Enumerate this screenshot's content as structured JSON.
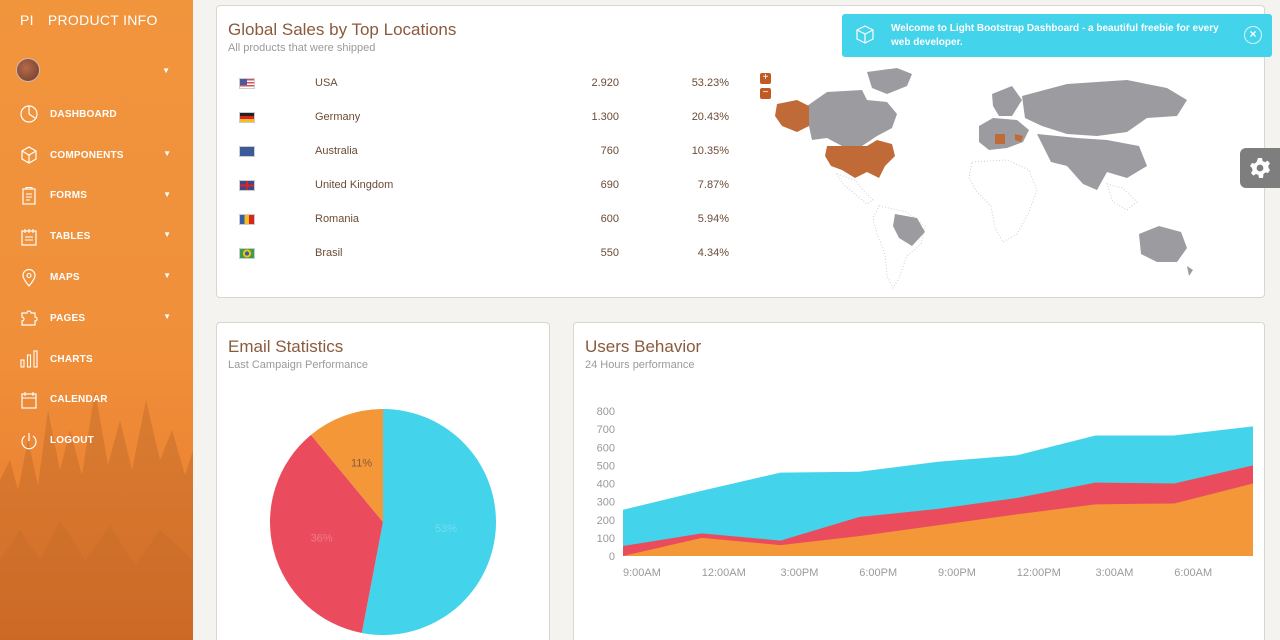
{
  "sidebar": {
    "logo_mini": "PI",
    "logo_text": "PRODUCT INFO",
    "items": [
      {
        "label": "DASHBOARD",
        "icon": "pie-chart-icon",
        "has_caret": false
      },
      {
        "label": "COMPONENTS",
        "icon": "cube-icon",
        "has_caret": true
      },
      {
        "label": "FORMS",
        "icon": "clipboard-icon",
        "has_caret": true
      },
      {
        "label": "TABLES",
        "icon": "notes-icon",
        "has_caret": true
      },
      {
        "label": "MAPS",
        "icon": "map-pin-icon",
        "has_caret": true
      },
      {
        "label": "PAGES",
        "icon": "puzzle-icon",
        "has_caret": true
      },
      {
        "label": "CHARTS",
        "icon": "bar-chart-icon",
        "has_caret": false
      },
      {
        "label": "CALENDAR",
        "icon": "calendar-icon",
        "has_caret": false
      },
      {
        "label": "LOGOUT",
        "icon": "power-icon",
        "has_caret": false
      }
    ]
  },
  "sales": {
    "title": "Global Sales by Top Locations",
    "subtitle": "All products that were shipped",
    "rows": [
      {
        "country": "USA",
        "value": "2.920",
        "percent": "53.23%"
      },
      {
        "country": "Germany",
        "value": "1.300",
        "percent": "20.43%"
      },
      {
        "country": "Australia",
        "value": "760",
        "percent": "10.35%"
      },
      {
        "country": "United Kingdom",
        "value": "690",
        "percent": "7.87%"
      },
      {
        "country": "Romania",
        "value": "600",
        "percent": "5.94%"
      },
      {
        "country": "Brasil",
        "value": "550",
        "percent": "4.34%"
      }
    ],
    "zoom_in": "+",
    "zoom_out": "−"
  },
  "notification": {
    "message": "Welcome to Light Bootstrap Dashboard - a beautiful freebie for every web developer.",
    "close": "×"
  },
  "email": {
    "title": "Email Statistics",
    "subtitle": "Last Campaign Performance",
    "slice_labels": [
      "53%",
      "36%",
      "11%"
    ]
  },
  "behavior": {
    "title": "Users Behavior",
    "subtitle": "24 Hours performance"
  },
  "colors": {
    "primary_orange": "#f1953d",
    "info_cyan": "#43d3ea",
    "danger_red": "#ea4c5d",
    "warning_orange": "#f39738",
    "map_highlight": "#c06a37",
    "map_gray": "#9c9ba0"
  },
  "chart_data": [
    {
      "type": "pie",
      "categories": [
        "",
        "",
        ""
      ],
      "values": [
        53,
        36,
        11
      ],
      "labels": [
        "53%",
        "36%",
        "11%"
      ],
      "colors": [
        "#43d3ea",
        "#ea4c5d",
        "#f39738"
      ]
    },
    {
      "type": "area",
      "categories": [
        "9:00AM",
        "12:00AM",
        "3:00PM",
        "6:00PM",
        "9:00PM",
        "12:00PM",
        "3:00AM",
        "6:00AM"
      ],
      "x": [
        0,
        1,
        2,
        3,
        4,
        5,
        6,
        7,
        8
      ],
      "series": [
        {
          "color": "#f39738",
          "values": [
            0,
            100,
            60,
            110,
            170,
            230,
            285,
            290,
            400
          ]
        },
        {
          "color": "#ea4c5d",
          "values": [
            55,
            125,
            85,
            215,
            260,
            320,
            405,
            400,
            500
          ]
        },
        {
          "color": "#43d3ea",
          "values": [
            255,
            360,
            460,
            465,
            520,
            555,
            665,
            665,
            715
          ]
        }
      ],
      "ylim": [
        0,
        800
      ],
      "yticks": [
        0,
        100,
        200,
        300,
        400,
        500,
        600,
        700,
        800
      ],
      "grid": false
    }
  ]
}
